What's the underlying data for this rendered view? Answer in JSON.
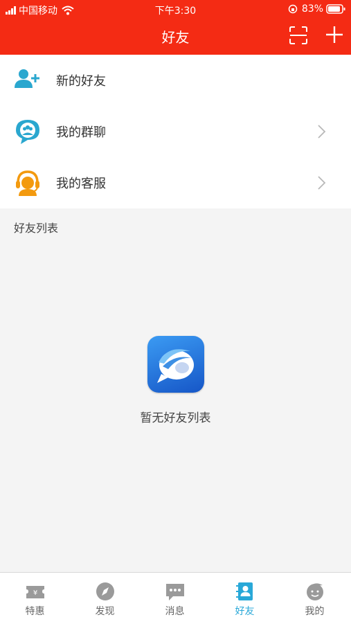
{
  "status_bar": {
    "carrier": "中国移动",
    "time": "下午3:30",
    "battery": "83%"
  },
  "header": {
    "title": "好友",
    "background": "#f42b14"
  },
  "menu": {
    "items": [
      {
        "label": "新的好友",
        "icon": "add-friend-icon"
      },
      {
        "label": "我的群聊",
        "icon": "group-chat-icon"
      },
      {
        "label": "我的客服",
        "icon": "customer-service-icon"
      }
    ]
  },
  "friends": {
    "section_label": "好友列表",
    "empty_text": "暂无好友列表"
  },
  "tabbar": {
    "active_color": "#29a8d8",
    "tabs": [
      {
        "label": "特惠",
        "icon": "ticket-icon"
      },
      {
        "label": "发现",
        "icon": "compass-icon"
      },
      {
        "label": "消息",
        "icon": "message-icon"
      },
      {
        "label": "好友",
        "icon": "contacts-icon",
        "active": true
      },
      {
        "label": "我的",
        "icon": "profile-face-icon"
      }
    ]
  }
}
